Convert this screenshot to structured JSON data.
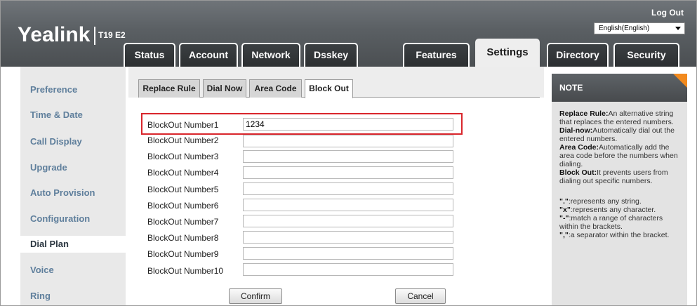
{
  "header": {
    "brand": "Yealink",
    "model": "T19 E2",
    "logout_label": "Log Out",
    "language": "English(English)"
  },
  "tabs": [
    {
      "label": "Status"
    },
    {
      "label": "Account"
    },
    {
      "label": "Network"
    },
    {
      "label": "Dsskey"
    },
    {
      "label": "Features"
    },
    {
      "label": "Settings"
    },
    {
      "label": "Directory"
    },
    {
      "label": "Security"
    }
  ],
  "active_tab": "Settings",
  "sidebar": {
    "items": [
      {
        "label": "Preference"
      },
      {
        "label": "Time & Date"
      },
      {
        "label": "Call Display"
      },
      {
        "label": "Upgrade"
      },
      {
        "label": "Auto Provision"
      },
      {
        "label": "Configuration"
      },
      {
        "label": "Dial Plan"
      },
      {
        "label": "Voice"
      },
      {
        "label": "Ring"
      }
    ],
    "active": "Dial Plan"
  },
  "subtabs": [
    {
      "label": "Replace Rule"
    },
    {
      "label": "Dial Now"
    },
    {
      "label": "Area Code"
    },
    {
      "label": "Block Out"
    }
  ],
  "active_subtab": "Block Out",
  "form": {
    "rows": [
      {
        "label": "BlockOut Number1",
        "value": "1234"
      },
      {
        "label": "BlockOut Number2",
        "value": ""
      },
      {
        "label": "BlockOut Number3",
        "value": ""
      },
      {
        "label": "BlockOut Number4",
        "value": ""
      },
      {
        "label": "BlockOut Number5",
        "value": ""
      },
      {
        "label": "BlockOut Number6",
        "value": ""
      },
      {
        "label": "BlockOut Number7",
        "value": ""
      },
      {
        "label": "BlockOut Number8",
        "value": ""
      },
      {
        "label": "BlockOut Number9",
        "value": ""
      },
      {
        "label": "BlockOut Number10",
        "value": ""
      }
    ],
    "confirm_label": "Confirm",
    "cancel_label": "Cancel"
  },
  "note": {
    "title": "NOTE",
    "replace_rule_term": "Replace Rule:",
    "replace_rule_text": "An alternative string that replaces the entered numbers.",
    "dial_now_term": "Dial-now:",
    "dial_now_text": "Automatically dial out the entered numbers.",
    "area_code_term": "Area Code:",
    "area_code_text": "Automatically add the area code before the numbers when dialing.",
    "block_out_term": "Block Out:",
    "block_out_text": "It prevents users from dialing out specific numbers.",
    "dot_term": "\".\"",
    "dot_text": ":represents any string.",
    "x_term": "\"x\"",
    "x_text": ":represents any character.",
    "dash_term": "\"-\"",
    "dash_text": ":match a range of characters within the brackets.",
    "comma_term": "\",\"",
    "comma_text": ":a separator within the bracket."
  },
  "colors": {
    "highlight": "#d9262c",
    "note_corner": "#f28a1e",
    "nav_text": "#5f7f9c"
  }
}
